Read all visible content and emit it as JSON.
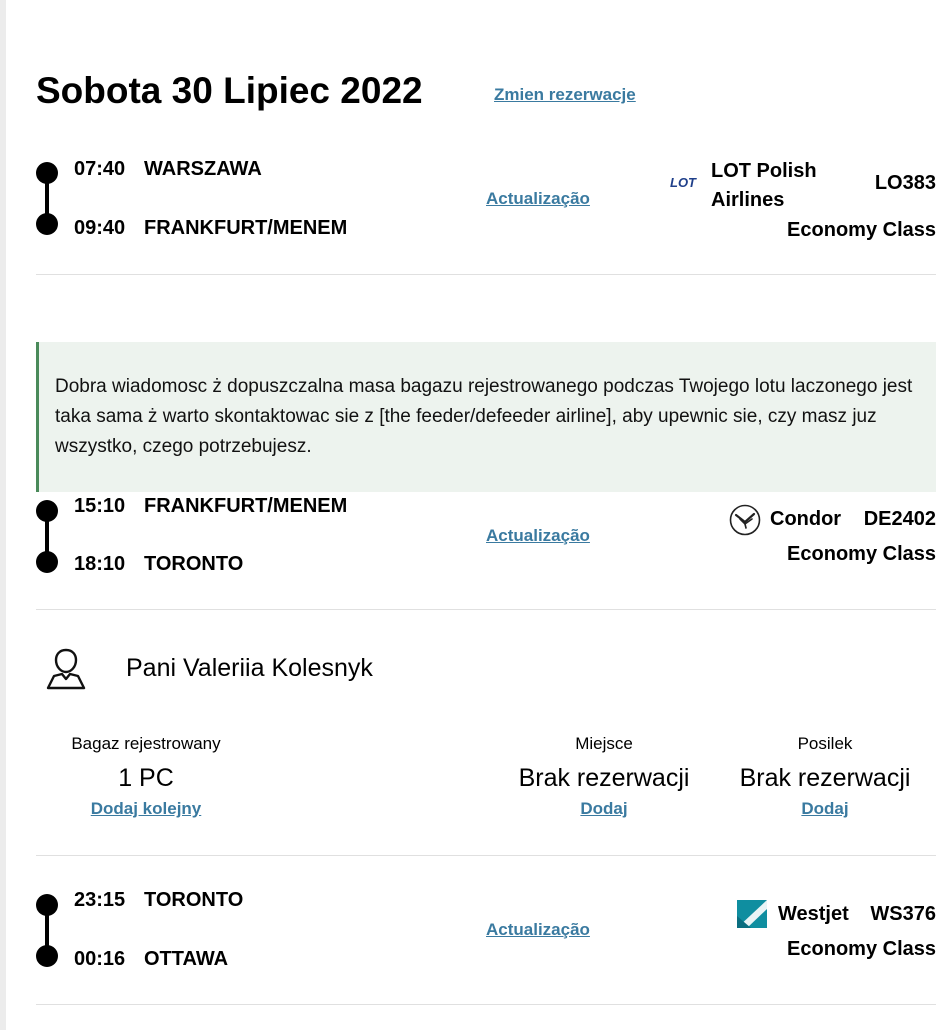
{
  "header": {
    "date_title": "Sobota 30 Lipiec 2022",
    "change_link": "Zmien rezerwacje"
  },
  "segments": [
    {
      "depart_time": "07:40",
      "depart_city": "WARSZAWA",
      "arrive_time": "09:40",
      "arrive_city": "FRANKFURT/MENEM",
      "update_link": "Actualização",
      "airline_line1": "LOT Polish",
      "airline_line2": "Airlines",
      "flight_no": "LO383",
      "cabin": "Economy Class",
      "logo_text": "LOT",
      "logo_icon": "lot-logo-icon"
    },
    {
      "depart_time": "15:10",
      "depart_city": "FRANKFURT/MENEM",
      "arrive_time": "18:10",
      "arrive_city": "TORONTO",
      "update_link": "Actualização",
      "airline": "Condor",
      "flight_no": "DE2402",
      "cabin": "Economy Class",
      "logo_icon": "condor-logo-icon"
    },
    {
      "depart_time": "23:15",
      "depart_city": "TORONTO",
      "arrive_time": "00:16",
      "arrive_city": "OTTAWA",
      "update_link": "Actualização",
      "airline": "Westjet",
      "flight_no": "WS376",
      "cabin": "Economy Class",
      "logo_icon": "westjet-logo-icon"
    }
  ],
  "info_message": "Dobra wiadomosc ż dopuszczalna masa bagazu rejestrowanego podczas Twojego lotu laczonego jest taka sama ż warto skontaktowac sie z [the feeder/defeeder airline], aby upewnic sie, czy masz juz wszystko, czego potrzebujesz.",
  "passenger": {
    "icon": "person-icon",
    "name": "Pani Valeriia Kolesnyk",
    "baggage": {
      "label": "Bagaz rejestrowany",
      "value": "1 PC",
      "link": "Dodaj kolejny"
    },
    "seat": {
      "label": "Miejsce",
      "value": "Brak rezerwacji",
      "link": "Dodaj"
    },
    "meal": {
      "label": "Posilek",
      "value": "Brak rezerwacji",
      "link": "Dodaj"
    }
  },
  "colors": {
    "link": "#3a7aa0",
    "info_bg": "#edf3ee",
    "info_border": "#4a8a5a"
  }
}
